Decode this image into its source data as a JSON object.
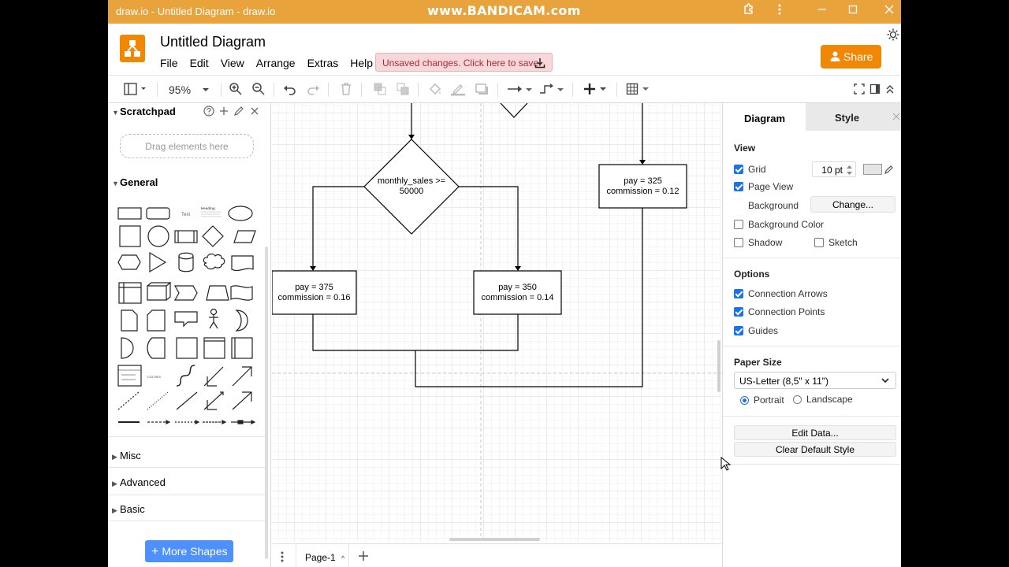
{
  "window": {
    "title": "draw.io - Untitled Diagram - draw.io",
    "watermark": "www.BANDICAM.com"
  },
  "header": {
    "doc_title": "Untitled Diagram",
    "menu": [
      "File",
      "Edit",
      "View",
      "Arrange",
      "Extras",
      "Help"
    ],
    "unsaved": "Unsaved changes. Click here to save.",
    "share": "Share"
  },
  "toolbar": {
    "zoom": "95%"
  },
  "left_panel": {
    "scratchpad": "Scratchpad",
    "drag_hint": "Drag elements here",
    "general": "General",
    "misc": "Misc",
    "advanced": "Advanced",
    "basic": "Basic",
    "more_shapes": "More Shapes",
    "shape_text_sample": "Text",
    "shape_heading_sample": "Heading",
    "shape_list_sample": "List Item"
  },
  "diagram": {
    "decision": "monthly_sales >= 50000",
    "box_left_line1": "pay = 375",
    "box_left_line2": "commission = 0.16",
    "box_mid_line1": "pay = 350",
    "box_mid_line2": "commission = 0.14",
    "box_right_line1": "pay = 325",
    "box_right_line2": "commission = 0.12"
  },
  "page_tabs": {
    "current": "Page-1"
  },
  "right_panel": {
    "tab_diagram": "Diagram",
    "tab_style": "Style",
    "view_title": "View",
    "grid": "Grid",
    "grid_size": "10 pt",
    "page_view": "Page View",
    "background": "Background",
    "change": "Change...",
    "background_color": "Background Color",
    "shadow": "Shadow",
    "sketch": "Sketch",
    "options_title": "Options",
    "connection_arrows": "Connection Arrows",
    "connection_points": "Connection Points",
    "guides": "Guides",
    "paper_size_title": "Paper Size",
    "paper_size": "US-Letter (8,5\" x 11\")",
    "portrait": "Portrait",
    "landscape": "Landscape",
    "edit_data": "Edit Data...",
    "clear_default_style": "Clear Default Style"
  },
  "colors": {
    "titlebar": "#e8a33d",
    "brand": "#f08705",
    "accent": "#1a73e8",
    "more_shapes": "#4d90fe"
  }
}
